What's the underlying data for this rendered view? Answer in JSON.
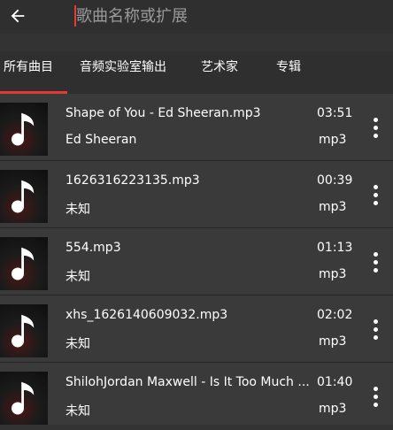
{
  "header": {
    "search_placeholder": "歌曲名称或扩展"
  },
  "tabs": [
    {
      "label": "所有曲目",
      "active": true
    },
    {
      "label": "音频实验室输出",
      "active": false
    },
    {
      "label": "艺术家",
      "active": false
    },
    {
      "label": "专辑",
      "active": false
    }
  ],
  "tracks": [
    {
      "title": "Shape of You - Ed Sheeran.mp3",
      "artist": "Ed Sheeran",
      "duration": "03:51",
      "format": "mp3"
    },
    {
      "title": "1626316223135.mp3",
      "artist": "未知",
      "duration": "00:39",
      "format": "mp3"
    },
    {
      "title": "554.mp3",
      "artist": "未知",
      "duration": "01:13",
      "format": "mp3"
    },
    {
      "title": "xhs_1626140609032.mp3",
      "artist": "未知",
      "duration": "02:02",
      "format": "mp3"
    },
    {
      "title": "ShilohJordan Maxwell - Is It Too Much ...",
      "artist": "未知",
      "duration": "01:40",
      "format": "mp3"
    }
  ],
  "icons": {
    "back": "arrow-left-icon",
    "thumb": "music-note-icon",
    "menu": "more-vertical-icon"
  },
  "colors": {
    "accent": "#e53935",
    "background": "#333333",
    "list_background": "#3a3a3a"
  }
}
